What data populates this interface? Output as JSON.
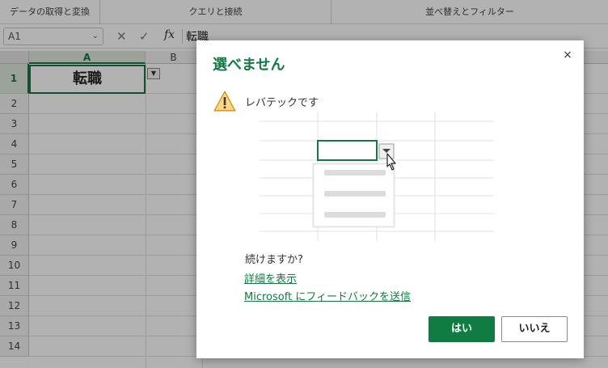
{
  "ribbon": {
    "groups": [
      "データの取得と変換",
      "クエリと接続",
      "並べ替えとフィルター"
    ]
  },
  "formula_bar": {
    "name_box": "A1",
    "fx_label": "fx",
    "value": "転職"
  },
  "sheet": {
    "columns": [
      "A",
      "B"
    ],
    "rows": [
      "1",
      "2",
      "3",
      "4",
      "5",
      "6",
      "7",
      "8",
      "9",
      "10",
      "11",
      "12",
      "13",
      "14"
    ],
    "cell_a1": "転職"
  },
  "dialog": {
    "title": "選べません",
    "message": "レバテックです",
    "question": "続けますか?",
    "link_details": "詳細を表示",
    "link_feedback": "Microsoft にフィードバックを送信",
    "yes_label": "はい",
    "no_label": "いいえ",
    "close_glyph": "×"
  },
  "colors": {
    "accent": "#107c41",
    "warning": "#f5a623"
  }
}
